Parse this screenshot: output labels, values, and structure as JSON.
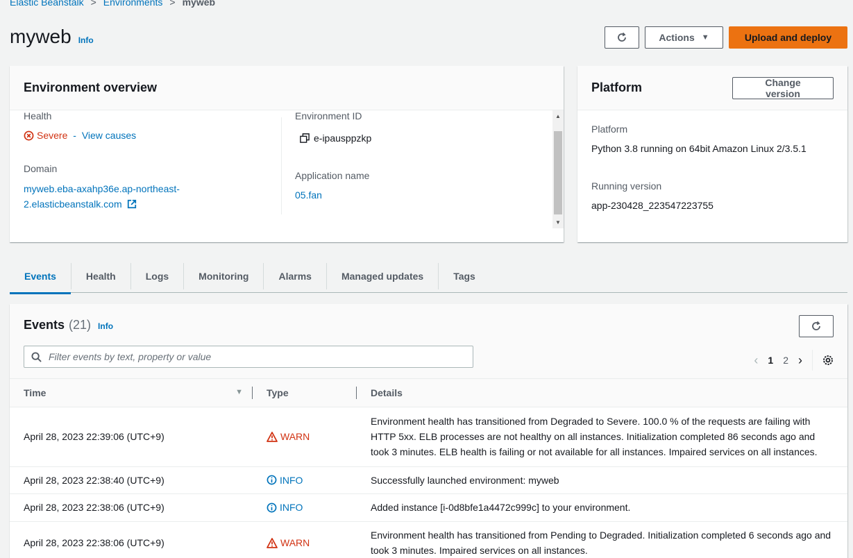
{
  "breadcrumb": {
    "items": [
      "Elastic Beanstalk",
      "Environments"
    ],
    "current": "myweb",
    "separator": ">"
  },
  "header": {
    "title": "myweb",
    "info": "Info",
    "actions_label": "Actions",
    "upload_label": "Upload and deploy"
  },
  "overview": {
    "title": "Environment overview",
    "health_label": "Health",
    "health_status": "Severe",
    "health_dash": " - ",
    "health_link": "View causes",
    "domain_label": "Domain",
    "domain_line1": "myweb.eba-axahp36e.ap-northeast-",
    "domain_line2": "2.elasticbeanstalk.com",
    "env_id_label": "Environment ID",
    "env_id": "e-ipausppzkp",
    "app_name_label": "Application name",
    "app_name": "05.fan"
  },
  "platform": {
    "title": "Platform",
    "change_label": "Change version",
    "platform_label": "Platform",
    "platform_value": "Python 3.8 running on 64bit Amazon Linux 2/3.5.1",
    "running_label": "Running version",
    "running_value": "app-230428_223547223755"
  },
  "tabs": [
    "Events",
    "Health",
    "Logs",
    "Monitoring",
    "Alarms",
    "Managed updates",
    "Tags"
  ],
  "events": {
    "title": "Events",
    "count": "(21)",
    "info": "Info",
    "search_placeholder": "Filter events by text, property or value",
    "pages": [
      "1",
      "2"
    ],
    "columns": {
      "time": "Time",
      "type": "Type",
      "details": "Details"
    },
    "rows": [
      {
        "time": "April 28, 2023 22:39:06 (UTC+9)",
        "type": "WARN",
        "details": "Environment health has transitioned from Degraded to Severe. 100.0 % of the requests are failing with HTTP 5xx. ELB processes are not healthy on all instances. Initialization completed 86 seconds ago and took 3 minutes. ELB health is failing or not available for all instances. Impaired services on all instances."
      },
      {
        "time": "April 28, 2023 22:38:40 (UTC+9)",
        "type": "INFO",
        "details": "Successfully launched environment: myweb"
      },
      {
        "time": "April 28, 2023 22:38:06 (UTC+9)",
        "type": "INFO",
        "details": "Added instance [i-0d8bfe1a4472c999c] to your environment."
      },
      {
        "time": "April 28, 2023 22:38:06 (UTC+9)",
        "type": "WARN",
        "details": "Environment health has transitioned from Pending to Degraded. Initialization completed 6 seconds ago and took 3 minutes. Impaired services on all instances."
      }
    ]
  },
  "colors": {
    "link": "#0073bb",
    "warn": "#d13212",
    "primary": "#ec7211",
    "severe": "#d13212"
  }
}
